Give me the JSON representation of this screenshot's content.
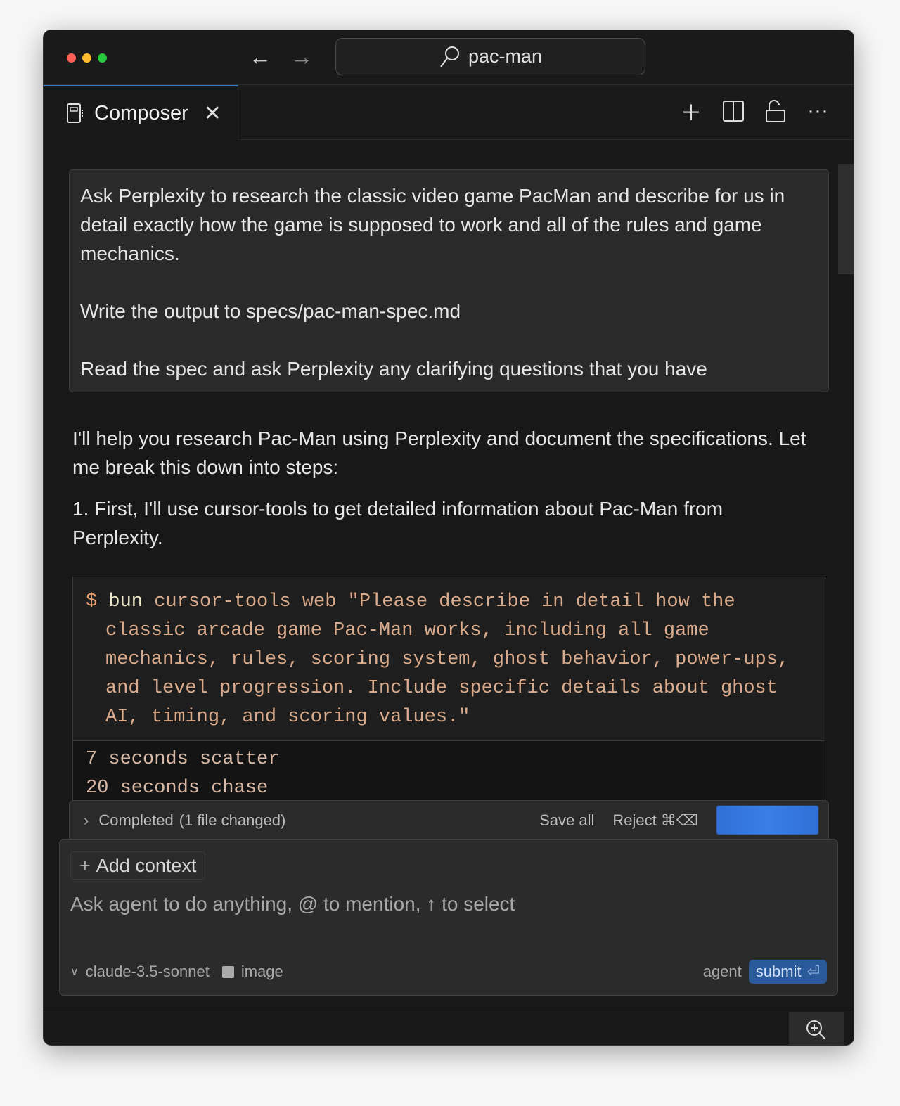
{
  "window": {
    "controls": [
      "close",
      "minimize",
      "maximize"
    ],
    "colors": {
      "close": "#ff5f57",
      "minimize": "#febc2e",
      "maximize": "#28c840"
    }
  },
  "search": {
    "value": "pac-man"
  },
  "tab": {
    "label": "Composer"
  },
  "prompt": {
    "paragraphs": [
      "Ask Perplexity to research the classic video game PacMan and describe for us in detail exactly how the game is supposed to work and all of the rules and game mechanics.",
      "Write the output to specs/pac-man-spec.md",
      "Read the spec and ask Perplexity any clarifying questions that you have"
    ]
  },
  "response": {
    "intro": "I'll help you research Pac-Man using Perplexity and document the specifications. Let me break this down into steps:",
    "step1": "1. First, I'll use cursor-tools to get detailed information about Pac-Man from Perplexity."
  },
  "code": {
    "prompt_symbol": "$",
    "command": "bun",
    "args": "cursor-tools web \"Please describe in detail how the classic arcade game Pac-Man works, including all game mechanics, rules, scoring system, ghost behavior, power-ups, and level progression. Include specific details about ghost AI, timing, and scoring values.\"",
    "output": [
      "7 seconds scatter",
      "20 seconds chase"
    ]
  },
  "status": {
    "label": "Completed",
    "detail": "(1 file changed)",
    "save_all": "Save all",
    "reject": "Reject ⌘⌫",
    "accent": "#3478e0"
  },
  "composer": {
    "add_context": "Add context",
    "placeholder": "Ask agent to do anything, @ to mention, ↑ to select",
    "model": "claude-3.5-sonnet",
    "image": "image",
    "mode": "agent",
    "submit": "submit"
  }
}
